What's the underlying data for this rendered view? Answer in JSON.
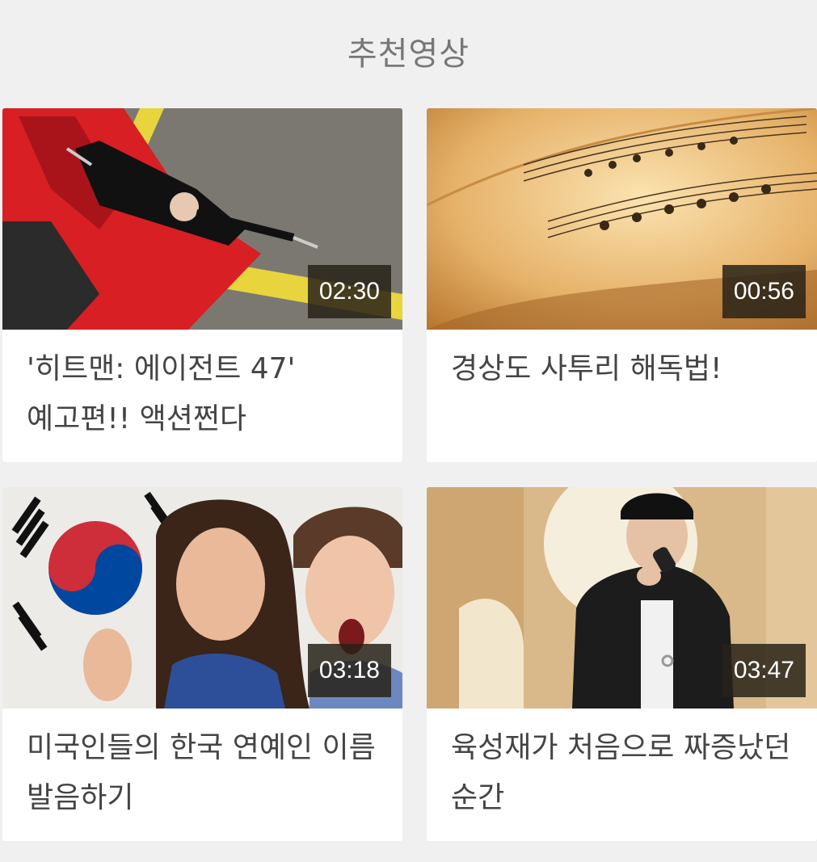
{
  "section": {
    "title": "추천영상"
  },
  "videos": [
    {
      "title": "'히트맨: 에이전트 47' 예고편!! 액션쩐다",
      "duration": "02:30",
      "thumbnail": "action-scene-red-car"
    },
    {
      "title": "경상도 사투리 해독법!",
      "duration": "00:56",
      "thumbnail": "sheet-music"
    },
    {
      "title": "미국인들의 한국 연예인 이름 발음하기",
      "duration": "03:18",
      "thumbnail": "korean-flag-celebrity"
    },
    {
      "title": "육성재가 처음으로 짜증났던 순간",
      "duration": "03:47",
      "thumbnail": "singer-microphone"
    }
  ]
}
